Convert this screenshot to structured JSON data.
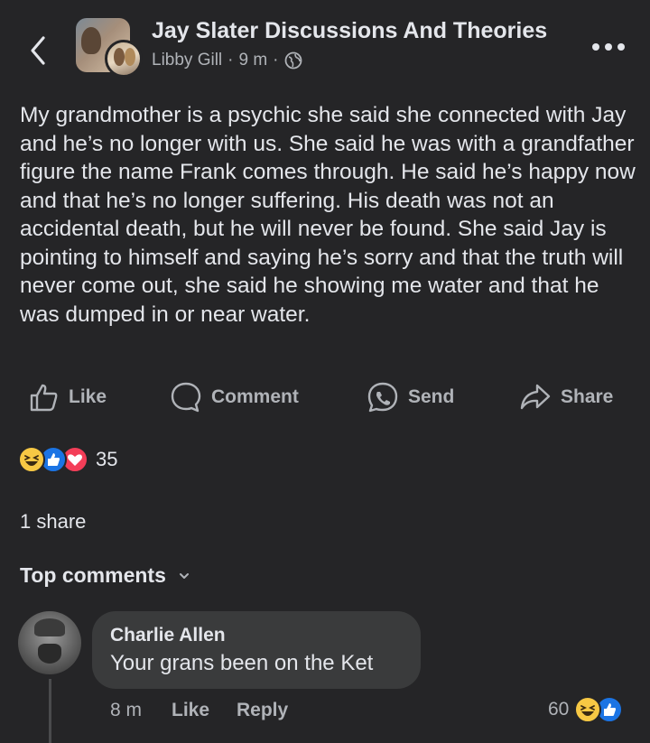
{
  "header": {
    "group_title": "Jay Slater Discussions And Theories",
    "author": "Libby Gill",
    "separator": "·",
    "time": "9 m",
    "icons": [
      "back-chevron-icon",
      "globe-icon",
      "more-icon"
    ]
  },
  "post": {
    "body": "My grandmother is a psychic she said she connected with Jay and he’s no longer with us. She said he was with a grandfather figure the name Frank comes through. He said he’s happy now and that he’s no longer suffering. His death was not an accidental death, but he will never be found. She said Jay is pointing to himself and saying he’s sorry and that the truth will never come out, she said he showing me water and that he was dumped in or near water."
  },
  "actions": {
    "like": "Like",
    "comment": "Comment",
    "send": "Send",
    "share": "Share"
  },
  "reactions": {
    "types": [
      "haha",
      "like",
      "love"
    ],
    "count": "35"
  },
  "shares": {
    "text": "1 share"
  },
  "comments_section": {
    "heading": "Top comments"
  },
  "comment": {
    "author": "Charlie Allen",
    "text": "Your grans been on the Ket",
    "time": "8 m",
    "like": "Like",
    "reply": "Reply",
    "reaction_count": "60",
    "reaction_types": [
      "haha",
      "like"
    ]
  },
  "colors": {
    "background": "#252527",
    "bubble": "#3a3b3c",
    "primary_text": "#e4e6eb",
    "secondary_text": "#b0b3b8",
    "like_blue": "#1b74e4",
    "love_red": "#f33e58",
    "haha_yellow": "#f7c844"
  }
}
